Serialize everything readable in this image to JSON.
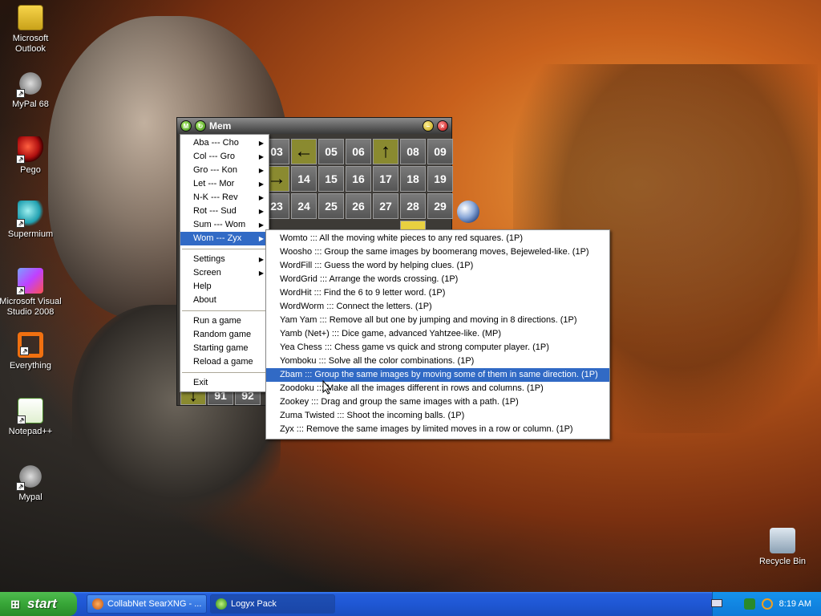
{
  "desktop_icons": [
    {
      "label": "Microsoft Outlook",
      "icon": "outlook-icon"
    },
    {
      "label": "MyPal 68",
      "icon": "mypal-icon"
    },
    {
      "label": "Pego",
      "icon": "pego-icon"
    },
    {
      "label": "Supermium",
      "icon": "supermium-icon"
    },
    {
      "label": "Microsoft Visual Studio 2008",
      "icon": "visual-studio-icon"
    },
    {
      "label": "Everything",
      "icon": "everything-icon"
    },
    {
      "label": "Notepad++",
      "icon": "notepad-icon"
    },
    {
      "label": "Mypal",
      "icon": "mypal-icon"
    },
    {
      "label": "Recycle Bin",
      "icon": "recycle-bin-icon"
    }
  ],
  "window": {
    "title": "Mem"
  },
  "grid": {
    "row1": [
      "03",
      "←",
      "05",
      "06",
      "↑",
      "08",
      "09"
    ],
    "row2": [
      "→",
      "14",
      "15",
      "16",
      "17",
      "18",
      "19"
    ],
    "row3": [
      "23",
      "24",
      "25",
      "26",
      "27",
      "28",
      "29"
    ],
    "bottom": [
      "↓",
      "91",
      "92"
    ]
  },
  "menu": {
    "items": [
      {
        "label": "Aba --- Cho",
        "sub": true
      },
      {
        "label": "Col --- Gro",
        "sub": true
      },
      {
        "label": "Gro --- Kon",
        "sub": true
      },
      {
        "label": "Let --- Mor",
        "sub": true
      },
      {
        "label": "N-K --- Rev",
        "sub": true
      },
      {
        "label": "Rot --- Sud",
        "sub": true
      },
      {
        "label": "Sum --- Wom",
        "sub": true
      },
      {
        "label": "Wom --- Zyx",
        "sub": true,
        "selected": true
      }
    ],
    "settings": "Settings",
    "screen": "Screen",
    "help": "Help",
    "about": "About",
    "run_game": "Run a game",
    "random_game": "Random game",
    "starting_game": "Starting game",
    "reload_game": "Reload a game",
    "exit": "Exit"
  },
  "submenu": {
    "items": [
      "Womto ::: All the moving white pieces to any red squares. (1P)",
      "Woosho ::: Group the same images by boomerang moves, Bejeweled-like. (1P)",
      "WordFill ::: Guess the word by helping clues. (1P)",
      "WordGrid ::: Arrange the words crossing. (1P)",
      "WordHit ::: Find the 6 to 9 letter word. (1P)",
      "WordWorm ::: Connect the letters. (1P)",
      "Yam Yam ::: Remove all but one by jumping and moving in 8 directions. (1P)",
      "Yamb (Net+) ::: Dice game, advanced Yahtzee-like. (MP)",
      "Yea Chess ::: Chess game vs quick and strong computer player. (1P)",
      "Yomboku ::: Solve all the color combinations. (1P)",
      "Zbam ::: Group the same images by moving some of them in same direction. (1P)",
      "Zoodoku ::: Make all the images different in rows and columns. (1P)",
      "Zookey ::: Drag and group the same images with a path. (1P)",
      "Zuma Twisted ::: Shoot the incoming balls. (1P)",
      "Zyx ::: Remove the same images by limited moves in a row or column. (1P)"
    ],
    "selected_index": 10
  },
  "taskbar": {
    "start_label": "start",
    "tasks": [
      {
        "label": "CollabNet SearXNG - ...",
        "active": false
      },
      {
        "label": "Logyx Pack",
        "active": true
      }
    ],
    "clock": "8:19 AM"
  }
}
